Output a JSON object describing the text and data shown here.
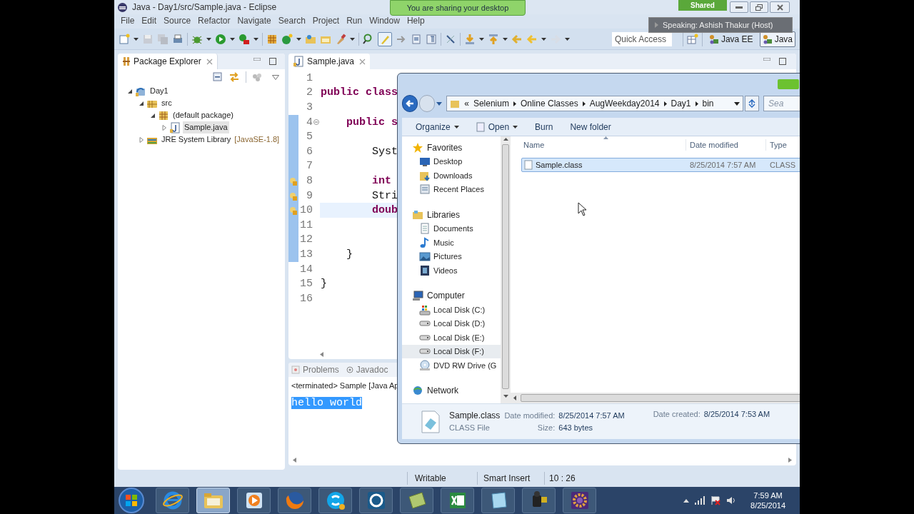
{
  "sharing": {
    "banner": "You are sharing your desktop",
    "status": "Shared",
    "speaker": "Speaking: Ashish Thakur (Host)"
  },
  "window": {
    "title": "Java - Day1/src/Sample.java - Eclipse"
  },
  "menu": [
    "File",
    "Edit",
    "Source",
    "Refactor",
    "Navigate",
    "Search",
    "Project",
    "Run",
    "Window",
    "Help"
  ],
  "toolbar": {
    "quick_access": {
      "placeholder": "Quick Access"
    },
    "perspectives": [
      {
        "label": "Java EE",
        "selected": false
      },
      {
        "label": "Java",
        "selected": true
      }
    ]
  },
  "package_explorer": {
    "title": "Package Explorer",
    "tree": [
      {
        "label": "Day1",
        "kind": "project",
        "expanded": true,
        "selected": false,
        "children": [
          {
            "label": "src",
            "kind": "source-folder",
            "expanded": true,
            "selected": false,
            "children": [
              {
                "label": "(default package)",
                "kind": "package",
                "expanded": true,
                "selected": false,
                "children": [
                  {
                    "label": "Sample.java",
                    "kind": "java-file",
                    "expanded": false,
                    "selected": true
                  }
                ]
              }
            ]
          },
          {
            "label": "JRE System Library",
            "suffix": "[JavaSE-1.8]",
            "kind": "library",
            "expanded": false,
            "selected": false
          }
        ]
      }
    ]
  },
  "editor": {
    "tab": "Sample.java",
    "lines": [
      {
        "number": "1",
        "changed": false,
        "warning": false,
        "current": false,
        "fold": false
      },
      {
        "number": "2",
        "code": [
          {
            "kind": "keyword",
            "text": "public class"
          }
        ],
        "changed": false,
        "warning": false,
        "current": false,
        "fold": false
      },
      {
        "number": "3",
        "changed": false,
        "warning": false,
        "current": false,
        "fold": false
      },
      {
        "number": "4",
        "code": [
          {
            "kind": "keyword",
            "text": "    public s"
          }
        ],
        "changed": true,
        "warning": false,
        "current": false,
        "fold": true
      },
      {
        "number": "5",
        "changed": true,
        "warning": false,
        "current": false,
        "fold": false
      },
      {
        "number": "6",
        "code": [
          {
            "kind": "plain",
            "text": "        Syst"
          }
        ],
        "changed": true,
        "warning": false,
        "current": false,
        "fold": false
      },
      {
        "number": "7",
        "changed": true,
        "warning": false,
        "current": false,
        "fold": false
      },
      {
        "number": "8",
        "code": [
          {
            "kind": "keyword",
            "text": "        int"
          }
        ],
        "changed": true,
        "warning": true,
        "current": false,
        "fold": false
      },
      {
        "number": "9",
        "code": [
          {
            "kind": "plain",
            "text": "        Stri"
          }
        ],
        "changed": true,
        "warning": true,
        "current": false,
        "fold": false
      },
      {
        "number": "10",
        "code": [
          {
            "kind": "keyword",
            "text": "        doub"
          }
        ],
        "changed": true,
        "warning": true,
        "current": true,
        "fold": false
      },
      {
        "number": "11",
        "changed": true,
        "warning": false,
        "current": false,
        "fold": false
      },
      {
        "number": "12",
        "changed": true,
        "warning": false,
        "current": false,
        "fold": false
      },
      {
        "number": "13",
        "code": [
          {
            "kind": "plain",
            "text": "    }"
          }
        ],
        "changed": true,
        "warning": false,
        "current": false,
        "fold": false
      },
      {
        "number": "14",
        "changed": false,
        "warning": false,
        "current": false,
        "fold": false
      },
      {
        "number": "15",
        "code": [
          {
            "kind": "plain",
            "text": "}"
          }
        ],
        "changed": false,
        "warning": false,
        "current": false,
        "fold": false
      },
      {
        "number": "16",
        "changed": false,
        "warning": false,
        "current": false,
        "fold": false
      }
    ]
  },
  "console": {
    "tabs": [
      "Problems",
      "Javadoc"
    ],
    "header": "<terminated> Sample [Java Ap",
    "output": {
      "text": "hello world",
      "selected": true
    }
  },
  "status_bar": [
    "Writable",
    "Smart Insert",
    "10 : 26"
  ],
  "file_explorer": {
    "address": {
      "overflow": "«",
      "crumbs": [
        "Selenium",
        "Online Classes",
        "AugWeekday2014",
        "Day1",
        "bin"
      ]
    },
    "search": {
      "placeholder": "Sea"
    },
    "commands": [
      {
        "label": "Organize",
        "menu": true,
        "icon": false
      },
      {
        "label": "Open",
        "menu": true,
        "icon": true
      },
      {
        "label": "Burn",
        "menu": false,
        "icon": false
      },
      {
        "label": "New folder",
        "menu": false,
        "icon": false
      }
    ],
    "nav": [
      {
        "label": "Favorites",
        "kind": "star",
        "items": [
          {
            "label": "Desktop",
            "kind": "desktop",
            "selected": false
          },
          {
            "label": "Downloads",
            "kind": "downloads",
            "selected": false
          },
          {
            "label": "Recent Places",
            "kind": "recent",
            "selected": false
          }
        ]
      },
      {
        "label": "Libraries",
        "kind": "libraries",
        "items": [
          {
            "label": "Documents",
            "kind": "document",
            "selected": false
          },
          {
            "label": "Music",
            "kind": "music",
            "selected": false
          },
          {
            "label": "Pictures",
            "kind": "pictures",
            "selected": false
          },
          {
            "label": "Videos",
            "kind": "videos",
            "selected": false
          }
        ]
      },
      {
        "label": "Computer",
        "kind": "computer",
        "items": [
          {
            "label": "Local Disk (C:)",
            "kind": "system-drive",
            "selected": false
          },
          {
            "label": "Local Disk (D:)",
            "kind": "drive",
            "selected": false
          },
          {
            "label": "Local Disk (E:)",
            "kind": "drive",
            "selected": false
          },
          {
            "label": "Local Disk (F:)",
            "kind": "drive",
            "selected": true
          },
          {
            "label": "DVD RW Drive (G",
            "kind": "dvd",
            "selected": false
          }
        ]
      },
      {
        "label": "Network",
        "kind": "network"
      }
    ],
    "columns": [
      "Name",
      "Date modified",
      "Type"
    ],
    "files": [
      {
        "name": "Sample.class",
        "date": "8/25/2014 7:57 AM",
        "type": "CLASS",
        "selected": true
      }
    ],
    "details": {
      "name": "Sample.class",
      "type": "CLASS File",
      "fields": [
        {
          "label": "Date modified:",
          "value": "8/25/2014 7:57 AM"
        },
        {
          "label": "Size:",
          "value": "643 bytes"
        },
        {
          "label": "Date created:",
          "value": "8/25/2014 7:53 AM"
        }
      ]
    }
  },
  "taskbar": {
    "apps": [
      {
        "kind": "browser-e",
        "active": false
      },
      {
        "kind": "folder",
        "active": true
      },
      {
        "kind": "media",
        "active": false
      },
      {
        "kind": "fox",
        "active": false
      },
      {
        "kind": "chat",
        "active": false
      },
      {
        "kind": "ring",
        "active": false
      },
      {
        "kind": "sheet-green",
        "active": false
      },
      {
        "kind": "spreadsheet",
        "active": false
      },
      {
        "kind": "notepad",
        "active": false
      },
      {
        "kind": "camcorder",
        "active": false
      },
      {
        "kind": "gear-box",
        "active": false
      }
    ],
    "clock": {
      "time": "7:59 AM",
      "date": "8/25/2014"
    }
  }
}
